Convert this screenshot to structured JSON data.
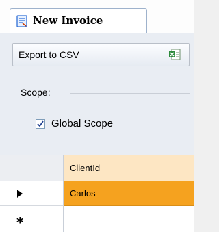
{
  "tab": {
    "label": "New Invoice",
    "icon": "invoice-form-icon"
  },
  "toolbar": {
    "export_label": "Export to CSV",
    "export_icon": "excel-file-icon"
  },
  "scope": {
    "group_label": "Scope:",
    "checkbox_label": "Global Scope",
    "checked": true
  },
  "grid": {
    "columns": [
      "ClientId"
    ],
    "rows": [
      {
        "ClientId": "Carlos",
        "selected": true
      }
    ],
    "current_row_icon": "row-pointer-icon",
    "new_row_glyph": "*"
  },
  "colors": {
    "tab_border": "#9eb2cc",
    "panel_bg": "#e9edf3",
    "header_bg": "#fde6c3",
    "selected_row": "#f5a21f"
  }
}
